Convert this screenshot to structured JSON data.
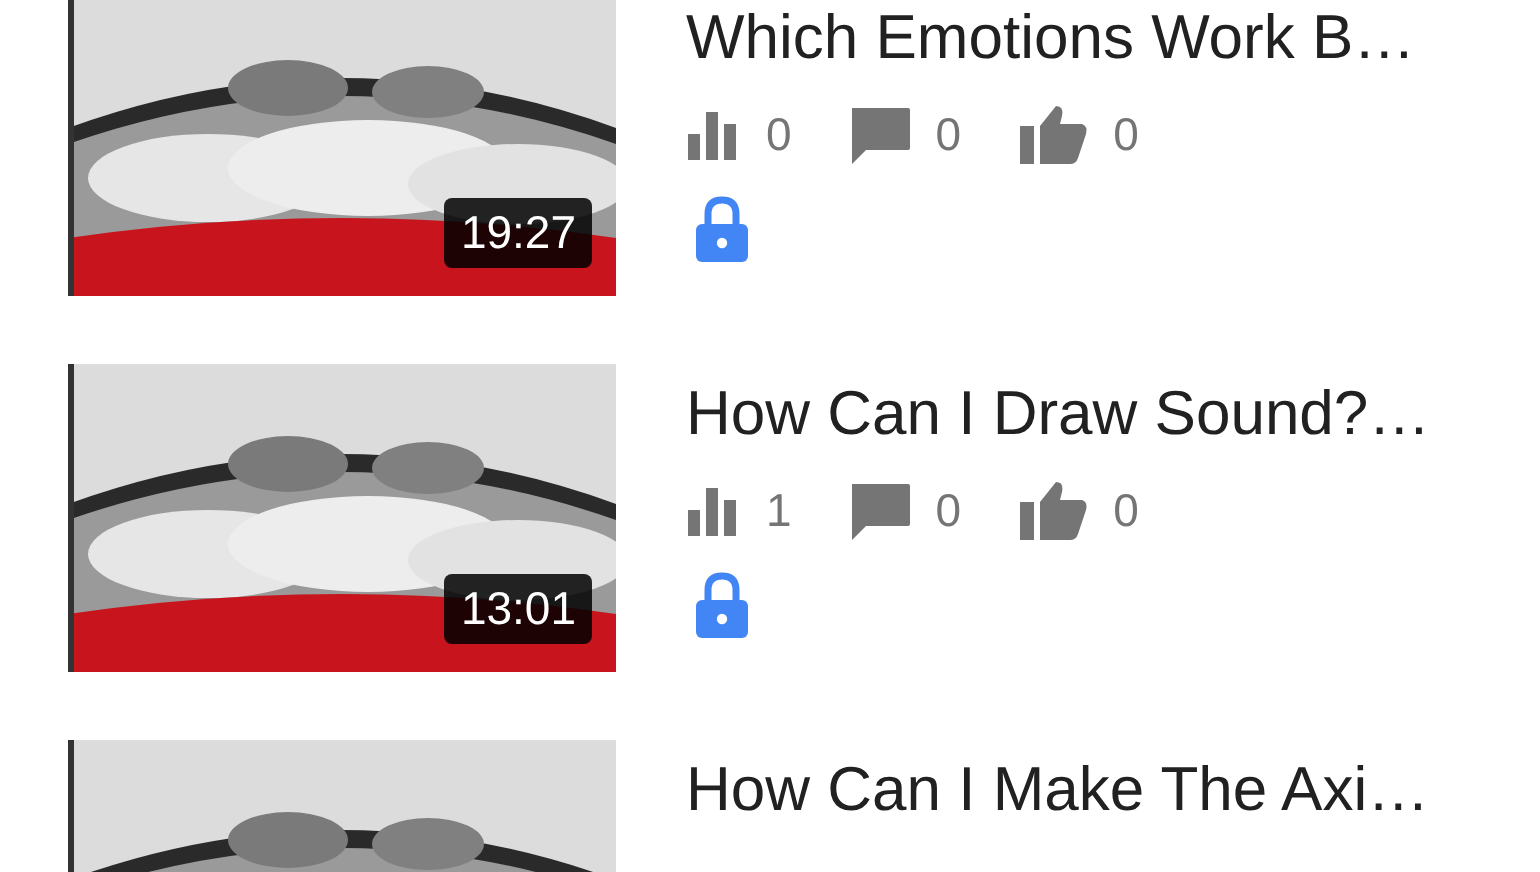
{
  "videos": [
    {
      "duration": "19:27",
      "title": "Which Emotions Work B…",
      "stats": {
        "views": "0",
        "comments": "0",
        "likes": "0"
      },
      "private": true
    },
    {
      "duration": "13:01",
      "title": "How Can I Draw Sound?…",
      "stats": {
        "views": "1",
        "comments": "0",
        "likes": "0"
      },
      "private": true
    },
    {
      "title": "How Can I Make The Axi…"
    }
  ]
}
